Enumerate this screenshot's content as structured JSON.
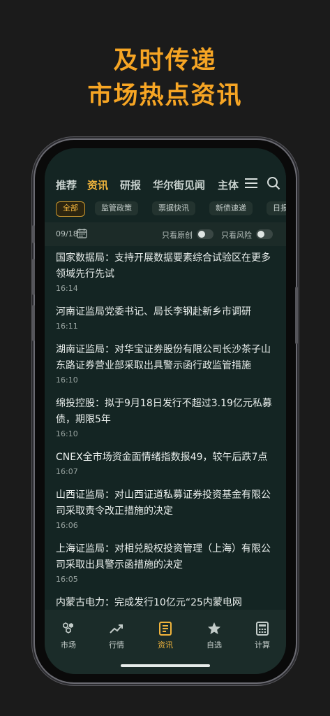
{
  "headline": {
    "line1": "及时传递",
    "line2": "市场热点资讯"
  },
  "tabs": [
    {
      "label": "推荐"
    },
    {
      "label": "资讯",
      "active": true
    },
    {
      "label": "研报"
    },
    {
      "label": "华尔街见闻"
    },
    {
      "label": "主体"
    }
  ],
  "chips": [
    {
      "label": "全部",
      "active": true
    },
    {
      "label": "监管政策"
    },
    {
      "label": "票据快讯"
    },
    {
      "label": "新债速递"
    },
    {
      "label": "日报"
    }
  ],
  "filter": {
    "date": "09/18",
    "original_only": "只看原创",
    "risk_only": "只看风险"
  },
  "news": [
    {
      "title": "国家数据局：支持开展数据要素综合试验区在更多领域先行先试",
      "time": "16:14"
    },
    {
      "title": "河南证监局党委书记、局长李钢赴新乡市调研",
      "time": "16:11"
    },
    {
      "title": "湖南证监局：对华宝证券股份有限公司长沙茶子山东路证券营业部采取出具警示函行政监管措施",
      "time": "16:10"
    },
    {
      "title": "绵投控股：拟于9月18日发行不超过3.19亿元私募债，期限5年",
      "time": "16:10"
    },
    {
      "title": "CNEX全市场资金面情绪指数报49，较午后跌7点",
      "time": "16:07"
    },
    {
      "title": "山西证监局：对山西证道私募证券投资基金有限公司采取责令改正措施的决定",
      "time": "16:06"
    },
    {
      "title": "上海证监局：对相兑股权投资管理（上海）有限公司采取出具警示函措施的决定",
      "time": "16:05"
    },
    {
      "title": "内蒙古电力：完成发行10亿元“25内蒙电网",
      "time": ""
    }
  ],
  "bottom_nav": [
    {
      "label": "市场",
      "icon": "hexagon-cluster-icon"
    },
    {
      "label": "行情",
      "icon": "trend-up-icon"
    },
    {
      "label": "资讯",
      "icon": "news-icon",
      "active": true
    },
    {
      "label": "自选",
      "icon": "star-icon"
    },
    {
      "label": "计算",
      "icon": "calculator-icon"
    }
  ],
  "colors": {
    "accent": "#f0b43c",
    "headline": "#f6a524",
    "screen_bg": "#142523"
  }
}
